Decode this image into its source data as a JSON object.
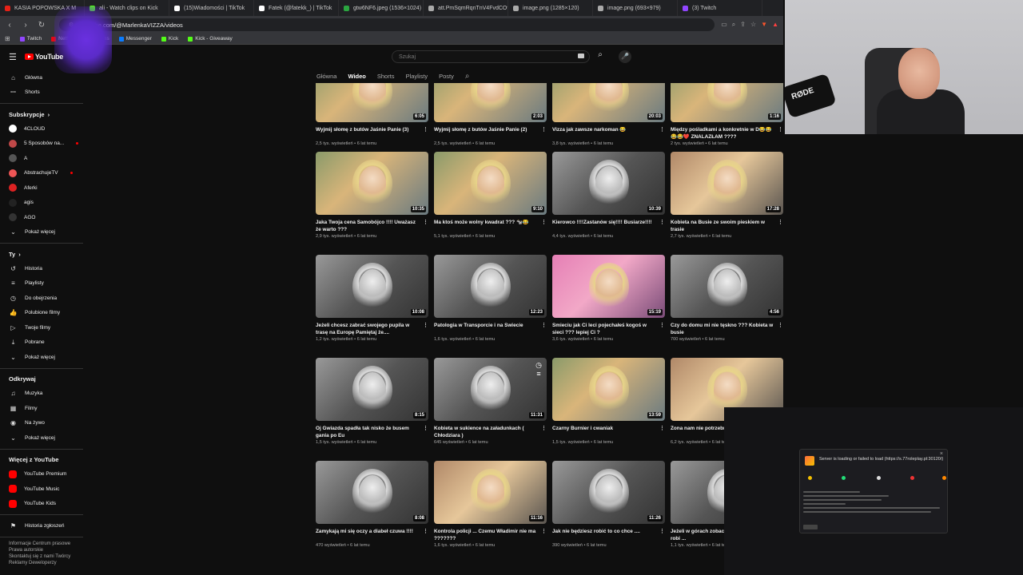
{
  "browser": {
    "tabs": [
      {
        "label": "KASIA POPOWSKA X M",
        "color": "#e62117"
      },
      {
        "label": "ali - Watch clips on Kick",
        "color": "#53fc18"
      },
      {
        "label": "(15)Wiadomości | TikTok",
        "color": "#ffffff"
      },
      {
        "label": "Fatek (@fatekk_) | TikTok",
        "color": "#ffffff"
      },
      {
        "label": "gtw6NF6.jpeg (1536×1024)",
        "color": "#2ba640"
      },
      {
        "label": "att.PmSqmRqnTnV4FvdCO9l",
        "color": "#aaaaaa"
      },
      {
        "label": "image.png (1285×120)",
        "color": "#aaaaaa"
      },
      {
        "label": "image.png (693×979)",
        "color": "#aaaaaa"
      },
      {
        "label": "(3) Twitch",
        "color": "#9146ff"
      }
    ],
    "url": "youtube.com/@MarlenkaVIZZA/videos",
    "bookmarks": [
      {
        "label": "Twitch",
        "color": "#9146ff"
      },
      {
        "label": "Netflix",
        "color": "#e50914"
      },
      {
        "label": "G4Skins",
        "color": "#e05b2a"
      },
      {
        "label": "Messenger",
        "color": "#0a7cff"
      },
      {
        "label": "Kick",
        "color": "#53fc18"
      },
      {
        "label": "Kick - Giveaway",
        "color": "#53fc18"
      }
    ]
  },
  "youtube": {
    "search_placeholder": "Szukaj",
    "channel_tabs": [
      "Główna",
      "Wideo",
      "Shorts",
      "Playlisty",
      "Posty"
    ],
    "active_tab": "Wideo"
  },
  "sidebar": {
    "main": [
      {
        "label": "Główna",
        "icon": "home-icon",
        "glyph": "⌂"
      },
      {
        "label": "Shorts",
        "icon": "shorts-icon",
        "glyph": "ꟷ"
      }
    ],
    "subs_header": "Subskrypcje",
    "subs": [
      {
        "label": "4CLOUD",
        "color": "#ffffff"
      },
      {
        "label": "5 Sposobów na...",
        "color": "#c04848",
        "live": true
      },
      {
        "label": "A",
        "color": "#555555"
      },
      {
        "label": "AbstrachujeTV",
        "color": "#e55",
        "live": true
      },
      {
        "label": "Aferki",
        "color": "#d22"
      },
      {
        "label": "agis",
        "color": "#222222"
      },
      {
        "label": "AGO",
        "color": "#333333"
      }
    ],
    "show_more": "Pokaż więcej",
    "you_header": "Ty",
    "you": [
      {
        "label": "Historia",
        "icon": "history-icon",
        "glyph": "↺"
      },
      {
        "label": "Playlisty",
        "icon": "playlist-icon",
        "glyph": "≡"
      },
      {
        "label": "Do obejrzenia",
        "icon": "clock-icon",
        "glyph": "◷"
      },
      {
        "label": "Polubione filmy",
        "icon": "like-icon",
        "glyph": "👍"
      },
      {
        "label": "Twoje filmy",
        "icon": "video-icon",
        "glyph": "▷"
      },
      {
        "label": "Pobrane",
        "icon": "download-icon",
        "glyph": "⤓"
      },
      {
        "label": "Pokaż więcej",
        "icon": "chevron-down-icon",
        "glyph": "⌄"
      }
    ],
    "explore_header": "Odkrywaj",
    "explore": [
      {
        "label": "Muzyka",
        "icon": "music-icon",
        "glyph": "♫"
      },
      {
        "label": "Filmy",
        "icon": "film-icon",
        "glyph": "▦"
      },
      {
        "label": "Na żywo",
        "icon": "live-icon",
        "glyph": "◉"
      },
      {
        "label": "Pokaż więcej",
        "icon": "chevron-down-icon",
        "glyph": "⌄"
      }
    ],
    "more_header": "Więcej z YouTube",
    "more": [
      {
        "label": "YouTube Premium",
        "color": "#f00"
      },
      {
        "label": "YouTube Music",
        "color": "#f00"
      },
      {
        "label": "YouTube Kids",
        "color": "#f00"
      }
    ],
    "report": "Historia zgłoszeń",
    "footer": [
      "Informacje  Centrum prasowe",
      "Prawa autorskie",
      "Skontaktuj się z nami  Twórcy",
      "Reklamy  Deweloperzy"
    ]
  },
  "videos": [
    [
      {
        "title": "Wyjmij słomę z butów Jaśnie Panie (3)",
        "meta": "2,5 tys. wyświetleń • 6 lat temu",
        "dur": "6:05",
        "style": "color"
      },
      {
        "title": "Wyjmij słomę z butów Jaśnie Panie (2)",
        "meta": "2,5 tys. wyświetleń • 6 lat temu",
        "dur": "2:03",
        "style": "color"
      },
      {
        "title": "Vizza jak zawsze narkoman 😂",
        "meta": "3,8 tys. wyświetleń • 6 lat temu",
        "dur": "20:03",
        "style": "color"
      },
      {
        "title": "Między pośladkami a konkretnie w D😂😂 😂😂❤️ ZNALAZŁAM ????",
        "meta": "2 tys. wyświetleń • 6 lat temu",
        "dur": "1:16",
        "style": "color"
      }
    ],
    [
      {
        "title": "Jaka Twoja cena Samobójco !!!! Uważasz że warto ???",
        "meta": "2,9 tys. wyświetleń • 6 lat temu",
        "dur": "10:35",
        "style": "color"
      },
      {
        "title": "Ma ktoś może wolny kwadrat ??? 🐄😂",
        "meta": "5,1 tys. wyświetleń • 6 lat temu",
        "dur": "9:10",
        "style": "color"
      },
      {
        "title": "Kierowco !!!!Zastanów się!!!! Busiarze!!!!",
        "meta": "4,4 tys. wyświetleń • 6 lat temu",
        "dur": "10:39",
        "style": "bw"
      },
      {
        "title": "Kobieta na Busie ze swoim pieskiem w trasie",
        "meta": "2,7 tys. wyświetleń • 6 lat temu",
        "dur": "17:28",
        "style": "warm"
      }
    ],
    [
      {
        "title": "Jeżeli chcesz zabrać swojego pupila w trasę na Europę Pamiętaj że....",
        "meta": "1,2 tys. wyświetleń • 6 lat temu",
        "dur": "10:08",
        "style": "bw"
      },
      {
        "title": "Patologia w Transporcie i na Świecie",
        "meta": "1,6 tys. wyświetleń • 6 lat temu",
        "dur": "12:23",
        "style": "bw"
      },
      {
        "title": "Śmieciu jak Ci leci pojechałeś kogoś w sieci ??? lepiej Ci ?",
        "meta": "3,6 tys. wyświetleń • 6 lat temu",
        "dur": "15:19",
        "style": "pink"
      },
      {
        "title": "Czy do domu mi nie tęskno ??? Kobieta w busie",
        "meta": "700 wyświetleń • 6 lat temu",
        "dur": "4:56",
        "style": "bw"
      }
    ],
    [
      {
        "title": "Oj Gwiazda spadła tak nisko że busem gania po Eu",
        "meta": "1,5 tys. wyświetleń • 6 lat temu",
        "dur": "8:15",
        "style": "bw"
      },
      {
        "title": "Kobieta w sukience na załadunkach ( Chłodziara )",
        "meta": "645 wyświetleń • 6 lat temu",
        "dur": "11:31",
        "style": "bw"
      },
      {
        "title": "Czarny Burnier i cwaniak",
        "meta": "1,5 tys. wyświetleń • 6 lat temu",
        "dur": "13:59",
        "style": "color"
      },
      {
        "title": "Żona nam nie potrzebna dzieci!",
        "meta": "6,2 tys. wyświetleń • 6 lat temu",
        "dur": "",
        "style": "warm"
      }
    ],
    [
      {
        "title": "Zamykają mi się oczy a diabeł czuwa !!!!",
        "meta": "470 wyświetleń • 6 lat temu",
        "dur": "8:08",
        "style": "bw"
      },
      {
        "title": "Kontrola policji ... Czemu Władimir nie ma ???????",
        "meta": "1,6 tys. wyświetleń • 6 lat temu",
        "dur": "11:16",
        "style": "warm"
      },
      {
        "title": "Jak nie będziesz robić to co chce ....",
        "meta": "390 wyświetleń • 6 lat temu",
        "dur": "11:26",
        "style": "bw"
      },
      {
        "title": "Jeżeli w górach zobaczysz kobietę która robi ...",
        "meta": "1,1 tys. wyświetleń • 6 lat temu",
        "dur": "",
        "style": "bw"
      }
    ]
  ],
  "overlay": {
    "rode_label": "RØDE",
    "dialog_title": "Server is loading or failed to load (https://s.77roleplay.pl:30120/)"
  }
}
